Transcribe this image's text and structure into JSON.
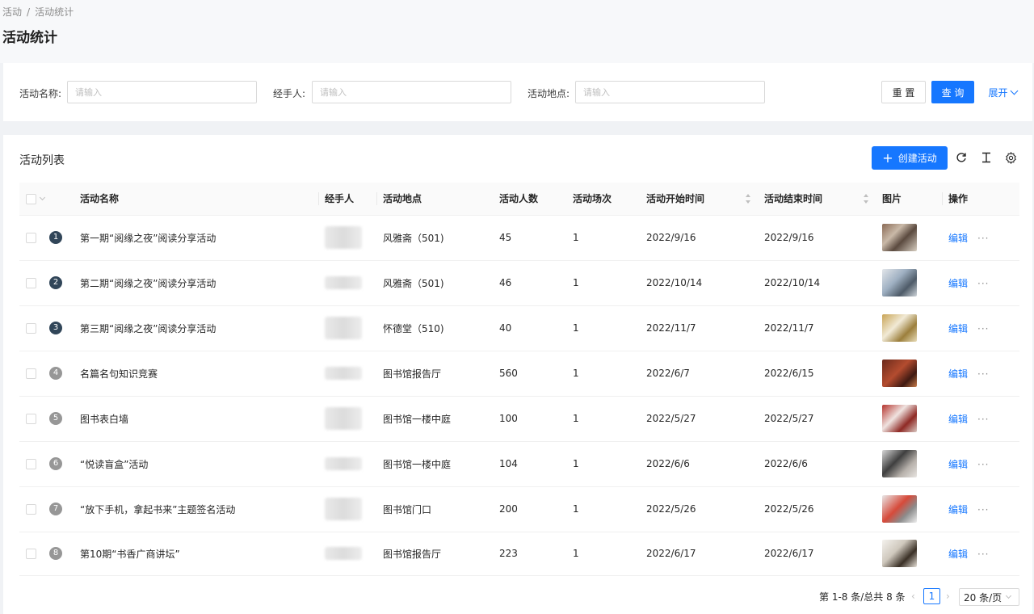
{
  "breadcrumb": [
    "活动",
    "活动统计"
  ],
  "page_title": "活动统计",
  "filters": {
    "name_label": "活动名称:",
    "name_placeholder": "请输入",
    "manager_label": "经手人:",
    "manager_placeholder": "请输入",
    "location_label": "活动地点:",
    "location_placeholder": "请输入",
    "reset": "重 置",
    "query": "查 询",
    "expand": "展开"
  },
  "list": {
    "title": "活动列表",
    "create_button": "创建活动",
    "columns": [
      "活动名称",
      "经手人",
      "活动地点",
      "活动人数",
      "活动场次",
      "活动开始时间",
      "活动结束时间",
      "图片",
      "操作"
    ],
    "rows": [
      {
        "index": "1",
        "name": "第一期“阅缘之夜”阅读分享活动",
        "location": "风雅斋（501)",
        "people": "45",
        "sessions": "1",
        "start": "2022/9/16",
        "end": "2022/9/16",
        "edit": "编辑",
        "more": "···"
      },
      {
        "index": "2",
        "name": "第二期“阅缘之夜”阅读分享活动",
        "location": "风雅斋（501)",
        "people": "46",
        "sessions": "1",
        "start": "2022/10/14",
        "end": "2022/10/14",
        "edit": "编辑",
        "more": "···"
      },
      {
        "index": "3",
        "name": "第三期“阅缘之夜”阅读分享活动",
        "location": "怀德堂（510)",
        "people": "40",
        "sessions": "1",
        "start": "2022/11/7",
        "end": "2022/11/7",
        "edit": "编辑",
        "more": "···"
      },
      {
        "index": "4",
        "name": "名篇名句知识竞赛",
        "location": "图书馆报告厅",
        "people": "560",
        "sessions": "1",
        "start": "2022/6/7",
        "end": "2022/6/15",
        "edit": "编辑",
        "more": "···"
      },
      {
        "index": "5",
        "name": "图书表白墙",
        "location": "图书馆一楼中庭",
        "people": "100",
        "sessions": "1",
        "start": "2022/5/27",
        "end": "2022/5/27",
        "edit": "编辑",
        "more": "···"
      },
      {
        "index": "6",
        "name": "“悦读盲盒”活动",
        "location": "图书馆一楼中庭",
        "people": "104",
        "sessions": "1",
        "start": "2022/6/6",
        "end": "2022/6/6",
        "edit": "编辑",
        "more": "···"
      },
      {
        "index": "7",
        "name": "“放下手机，拿起书来”主题签名活动",
        "location": "图书馆门口",
        "people": "200",
        "sessions": "1",
        "start": "2022/5/26",
        "end": "2022/5/26",
        "edit": "编辑",
        "more": "···"
      },
      {
        "index": "8",
        "name": "第10期“书香广商讲坛”",
        "location": "图书馆报告厅",
        "people": "223",
        "sessions": "1",
        "start": "2022/6/17",
        "end": "2022/6/17",
        "edit": "编辑",
        "more": "···"
      }
    ]
  },
  "pagination": {
    "total_text": "第 1-8 条/总共 8 条",
    "current_page": "1",
    "page_size": "20 条/页"
  },
  "colors": {
    "primary": "#1677ff",
    "index_dark": "#314659",
    "index_gray": "#979797"
  },
  "icons": [
    "plus-icon",
    "reload-icon",
    "column-height-icon",
    "setting-icon",
    "chevron-down-icon",
    "chevron-left-icon",
    "chevron-right-icon",
    "sort-icon"
  ]
}
